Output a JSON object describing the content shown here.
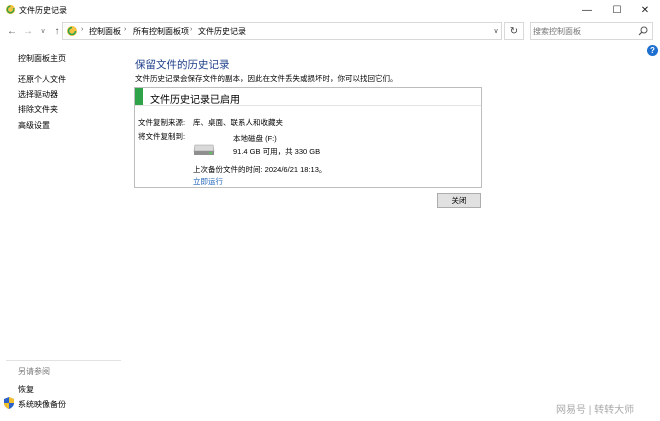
{
  "window": {
    "title": "文件历史记录",
    "controls": {
      "minimize": "—",
      "maximize": "☐",
      "close": "✕"
    }
  },
  "nav": {
    "back": "←",
    "forward": "→",
    "recent": "∨",
    "up": "↑",
    "breadcrumbs": [
      "控制面板",
      "所有控制面板项",
      "文件历史记录"
    ],
    "separator": "›",
    "dropdown": "∨",
    "refresh": "↻",
    "search_placeholder": "搜索控制面板"
  },
  "sidebar": {
    "home": "控制面板主页",
    "items": [
      {
        "label": "还原个人文件"
      },
      {
        "label": "选择驱动器"
      },
      {
        "label": "排除文件夹"
      },
      {
        "label": "高级设置"
      }
    ],
    "see_also_heading": "另请参阅",
    "see_also": [
      {
        "label": "恢复"
      },
      {
        "label": "系统映像备份"
      }
    ]
  },
  "help": "?",
  "main": {
    "title": "保留文件的历史记录",
    "description": "文件历史记录会保存文件的副本，因此在文件丢失或损坏时，你可以找回它们。",
    "panel": {
      "status": "文件历史记录已启用",
      "copy_from_label": "文件复制来源:",
      "copy_from_value": "库、桌面、联系人和收藏夹",
      "copy_to_label": "将文件复制到:",
      "drive_name": "本地磁盘 (F:)",
      "drive_space": "91.4 GB 可用，共 330 GB",
      "last_backup": "上次备份文件的时间: 2024/6/21 18:13。",
      "run_now": "立即运行"
    },
    "close_button": "关闭"
  },
  "watermark": "网易号 | 转转大师",
  "colors": {
    "status_green": "#2ea34a",
    "title_blue": "#1e3f8a",
    "link_blue": "#1e63b8",
    "help_blue": "#1e6fcf"
  }
}
